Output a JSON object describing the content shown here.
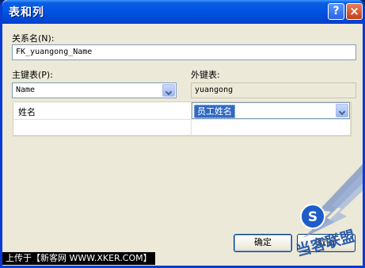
{
  "window": {
    "title": "表和列"
  },
  "titlebar_buttons": {
    "help": "?",
    "close": "×"
  },
  "relation": {
    "label": "关系名(N):",
    "value": "FK_yuangong_Name"
  },
  "primary_table": {
    "label": "主键表(P):",
    "value": "Name"
  },
  "foreign_table": {
    "label": "外键表:",
    "value": "yuangong"
  },
  "columns_grid": {
    "rows": [
      {
        "primary_column": "姓名",
        "foreign_column": "员工姓名"
      },
      {
        "primary_column": "",
        "foreign_column": ""
      }
    ]
  },
  "buttons": {
    "ok": "确定",
    "cancel": "取消"
  },
  "watermark": {
    "text": "上传于【新客网 WWW.XKER.COM】"
  },
  "logo": {
    "letter": "S",
    "text": "当客联盟"
  },
  "colors": {
    "title_blue": "#0054e3",
    "selection": "#316ac5",
    "dialog_bg": "#ece9d8"
  }
}
